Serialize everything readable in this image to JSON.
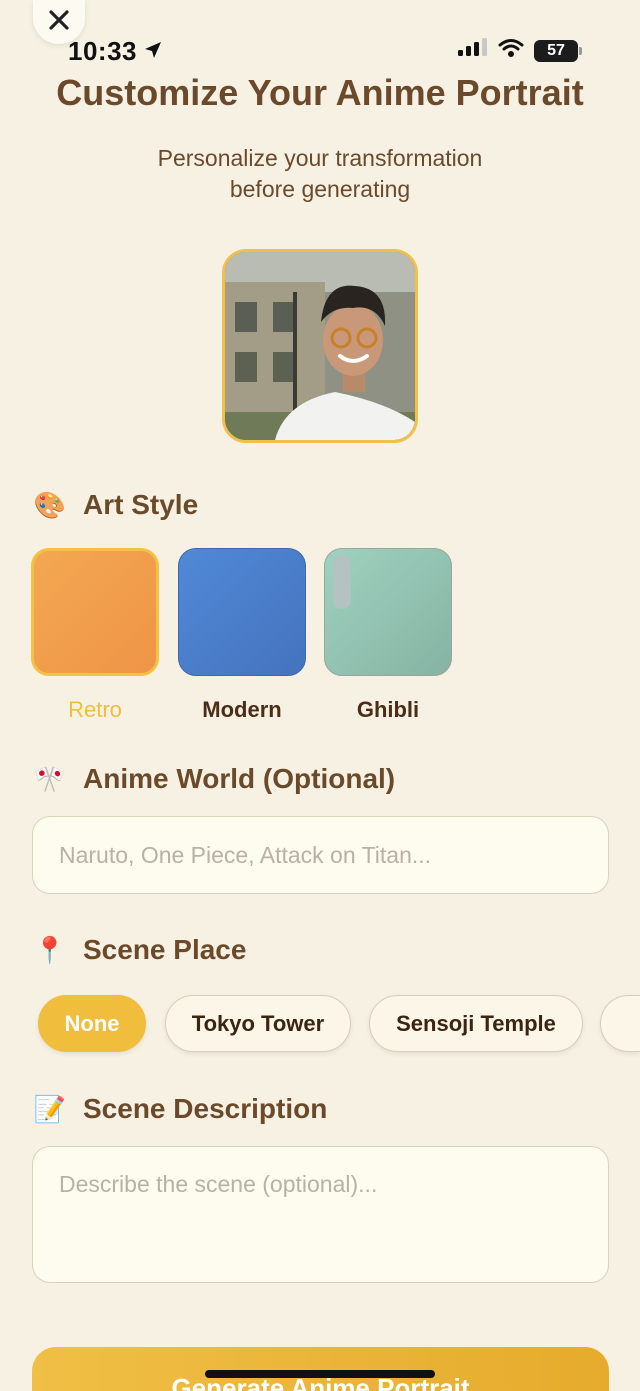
{
  "status_bar": {
    "time": "10:33",
    "battery": "57"
  },
  "header": {
    "title": "Customize Your Anime Portrait",
    "subtitle_line1": "Personalize your transformation",
    "subtitle_line2": "before generating"
  },
  "art_style": {
    "heading": "Art Style",
    "emoji": "🎨",
    "options": [
      {
        "label": "Retro",
        "selected": true,
        "color": "#f2a14a"
      },
      {
        "label": "Modern",
        "selected": false,
        "color": "#4f83cf"
      },
      {
        "label": "Ghibli",
        "selected": false,
        "color": "#94c9b7"
      }
    ]
  },
  "anime_world": {
    "heading": "Anime World (Optional)",
    "emoji": "🎌",
    "placeholder": "Naruto, One Piece, Attack on Titan..."
  },
  "scene_place": {
    "heading": "Scene Place",
    "emoji": "📍",
    "chips": [
      {
        "label": "None",
        "selected": true
      },
      {
        "label": "Tokyo Tower",
        "selected": false
      },
      {
        "label": "Sensoji Temple",
        "selected": false
      }
    ]
  },
  "scene_description": {
    "heading": "Scene Description",
    "emoji": "📝",
    "placeholder": "Describe the scene (optional)..."
  },
  "generate_button": {
    "label": "Generate Anime Portrait"
  },
  "colors": {
    "accent": "#f1bd3c",
    "text_brown": "#6b4a2b",
    "background": "#f6f1e2"
  }
}
